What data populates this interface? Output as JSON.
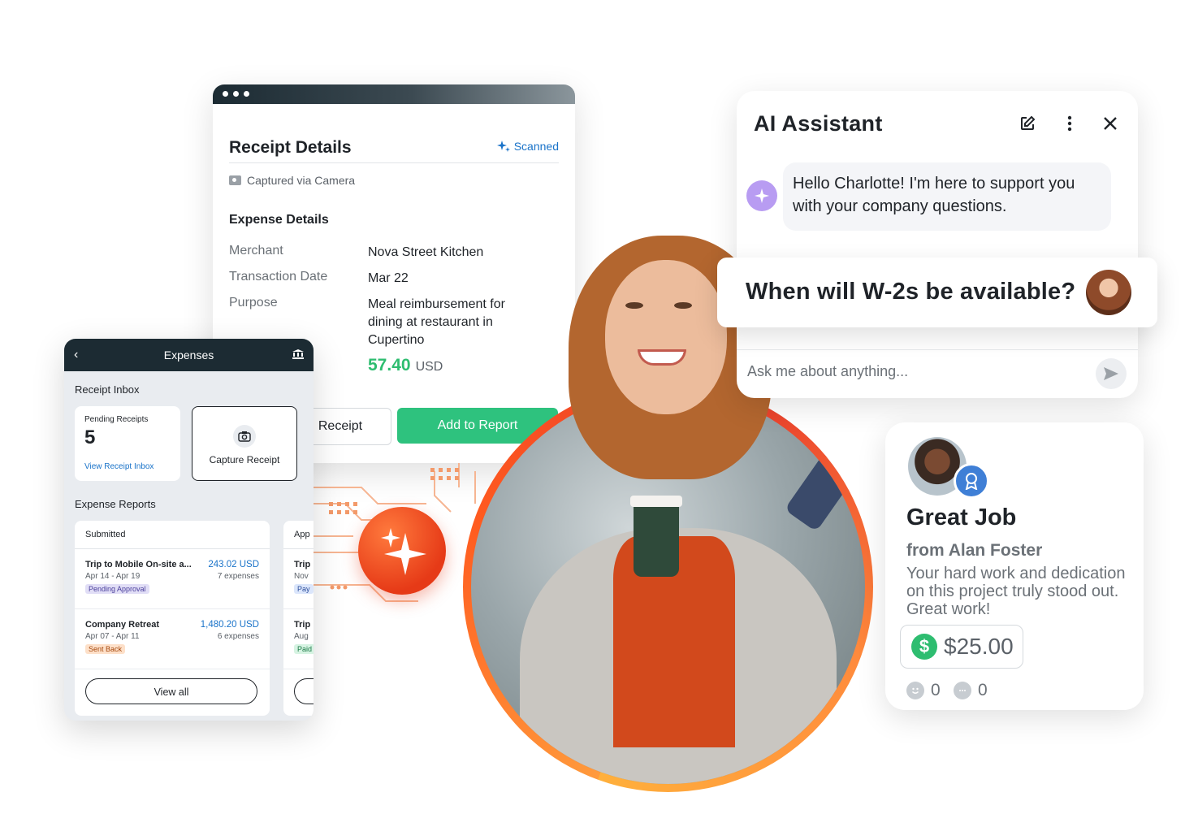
{
  "receipt": {
    "title": "Receipt Details",
    "scanned": "Scanned",
    "captured": "Captured via Camera",
    "section": "Expense Details",
    "merchant_label": "Merchant",
    "merchant": "Nova Street Kitchen",
    "date_label": "Transaction Date",
    "date": "Mar 22",
    "purpose_label": "Purpose",
    "purpose": "Meal reimbursement for dining at restaurant in Cupertino",
    "amount": "57.40",
    "currency": "USD",
    "secondary_button": "Receipt",
    "primary_button": "Add to Report"
  },
  "expenses": {
    "title": "Expenses",
    "inbox_heading": "Receipt Inbox",
    "pending_label": "Pending Receipts",
    "pending_count": "5",
    "view_inbox": "View Receipt Inbox",
    "capture": "Capture Receipt",
    "reports_heading": "Expense Reports",
    "submitted": {
      "header": "Submitted",
      "items": [
        {
          "title": "Trip to Mobile On-site a...",
          "amount": "243.02 USD",
          "dates": "Apr 14 - Apr 19",
          "count": "7 expenses",
          "status": "Pending Approval"
        },
        {
          "title": "Company Retreat",
          "amount": "1,480.20 USD",
          "dates": "Apr 07 - Apr 11",
          "count": "6 expenses",
          "status": "Sent Back"
        }
      ],
      "view_all": "View all"
    },
    "approved": {
      "header": "App",
      "items": [
        {
          "title": "Trip",
          "dates": "Nov",
          "status": "Pay"
        },
        {
          "title": "Trip",
          "dates": "Aug",
          "status": "Paid"
        }
      ]
    }
  },
  "assistant": {
    "title": "AI Assistant",
    "greeting": "Hello Charlotte! I'm here to support you with your company questions.",
    "question": "When will W-2s be available?",
    "input_placeholder": "Ask me about anything..."
  },
  "kudos": {
    "title": "Great Job",
    "from": "from Alan Foster",
    "message": "Your hard work and dedication on this project truly stood out. Great work!",
    "amount": "$25.00",
    "reactions": "0",
    "comments": "0"
  },
  "colors": {
    "accent_green": "#2ec27e",
    "link_blue": "#1a73c9",
    "orange": "#ff5a1f",
    "dark_header": "#1c2b33"
  }
}
